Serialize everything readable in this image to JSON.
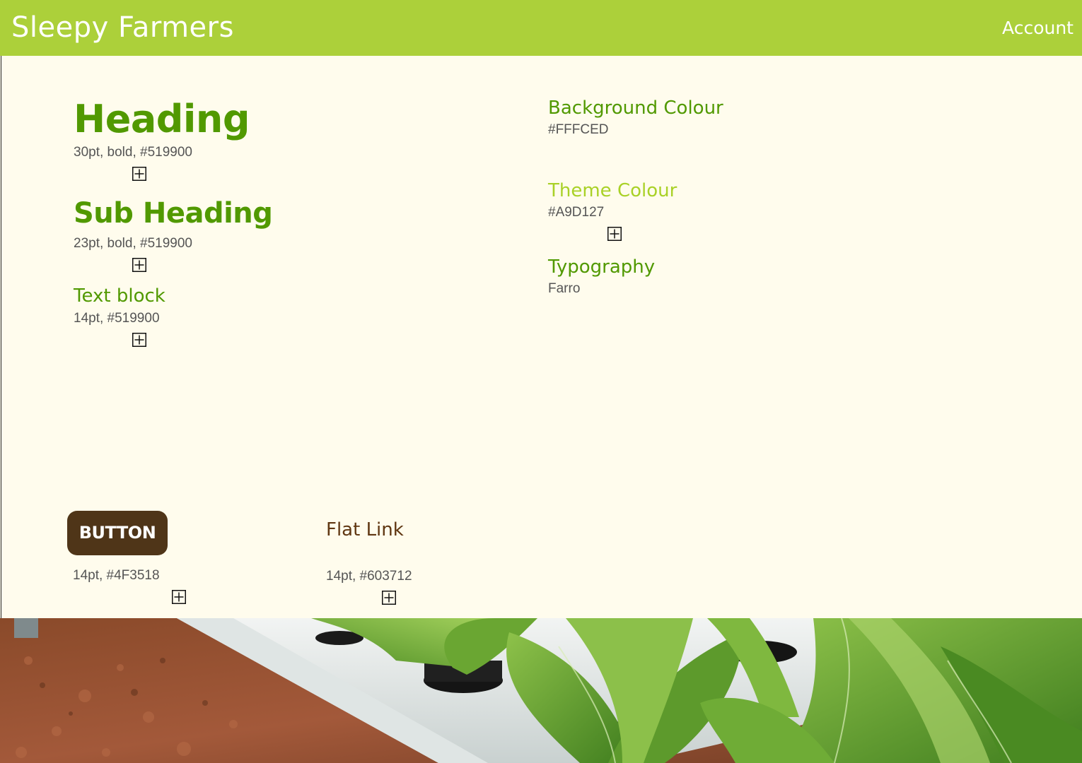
{
  "header": {
    "brand": "Sleepy Farmers",
    "account_label": "Account",
    "background": "#A9D127"
  },
  "styleguide": {
    "heading": {
      "sample": "Heading",
      "spec": "30pt, bold, #519900",
      "color": "#519900"
    },
    "subheading": {
      "sample": "Sub Heading",
      "spec": "23pt, bold, #519900",
      "color": "#519900"
    },
    "text_block": {
      "sample": "Text block",
      "spec": "14pt, #519900",
      "color": "#519900"
    },
    "background_colour": {
      "label": "Background Colour",
      "value": "#FFFCED"
    },
    "theme_colour": {
      "label": "Theme Colour",
      "value": "#A9D127"
    },
    "typography": {
      "label": "Typography",
      "value": "Farro"
    },
    "button": {
      "label": "BUTTON",
      "spec": "14pt, #4F3518",
      "color": "#4F3518"
    },
    "flat_link": {
      "label": "Flat Link",
      "spec": "14pt, #603712",
      "color": "#603712"
    }
  },
  "icons": {
    "expand": "plus-box-icon"
  }
}
